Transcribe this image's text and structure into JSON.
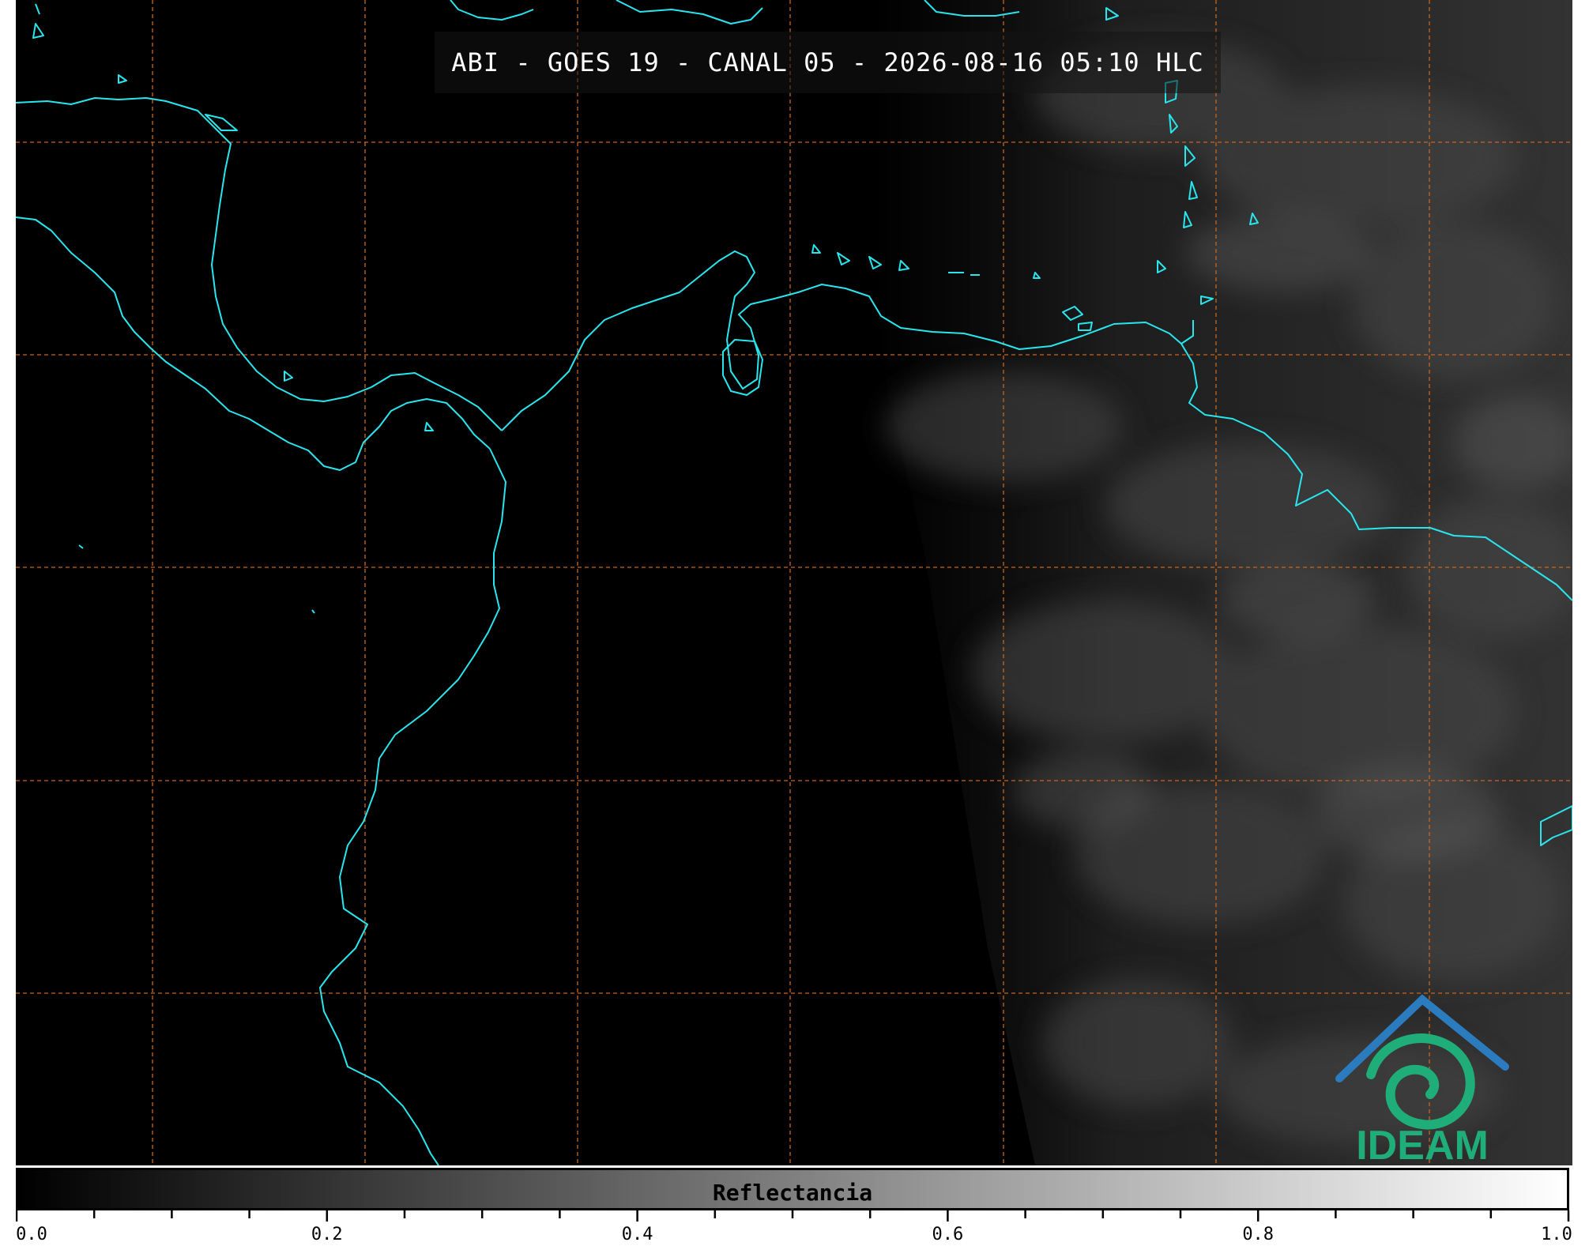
{
  "title": "ABI - GOES 19 - CANAL 05 - 2026-08-16 05:10 HLC",
  "logo": {
    "text": "IDEAM",
    "icon": "ideam-logo-icon"
  },
  "colorbar": {
    "label": "Reflectancia",
    "min": 0.0,
    "max": 1.0,
    "tick_labels": [
      "0.0",
      "0.2",
      "0.4",
      "0.6",
      "0.8",
      "1.0"
    ],
    "minor_ticks_per_major": 4
  },
  "colors": {
    "coastline": "#29e6ee",
    "grid": "#c8651e",
    "background": "#000000",
    "logo_blue": "#2b7bbf",
    "logo_green": "#1fae7a"
  }
}
